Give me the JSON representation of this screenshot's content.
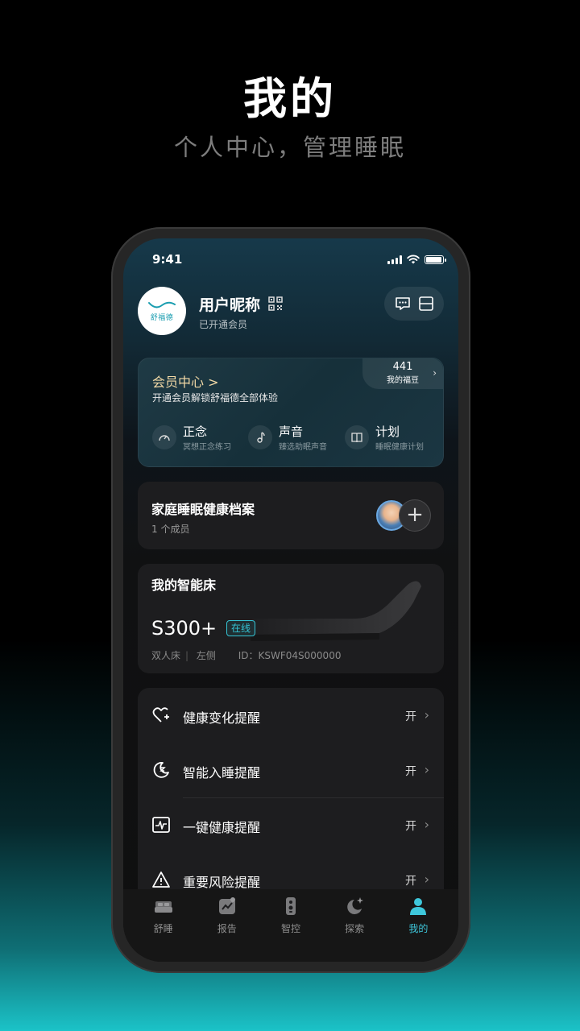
{
  "hero": {
    "title": "我的",
    "subtitle": "个人中心，管理睡眠"
  },
  "status_bar": {
    "time": "9:41",
    "battery_level": 0.95
  },
  "profile": {
    "avatar_brand": "舒福德",
    "nickname": "用户昵称",
    "member_status": "已开通会员",
    "actions": [
      "message-icon",
      "scan-icon"
    ]
  },
  "vip": {
    "title": "会员中心 >",
    "description": "开通会员解锁舒福德全部体验",
    "points_value": "441",
    "points_label": "我的福豆",
    "features": [
      {
        "title": "正念",
        "subtitle": "冥想正念练习",
        "icon": "gauge-icon"
      },
      {
        "title": "声音",
        "subtitle": "臻选助眠声音",
        "icon": "music-note-icon"
      },
      {
        "title": "计划",
        "subtitle": "睡眠健康计划",
        "icon": "book-icon"
      }
    ]
  },
  "family": {
    "title": "家庭睡眠健康档案",
    "count": "1 个成员",
    "add_label": "+"
  },
  "bed": {
    "title": "我的智能床",
    "model": "S300+",
    "status": "在线",
    "type": "双人床",
    "side": "左侧",
    "device_id": "ID：KSWF04S000000"
  },
  "reminders": [
    {
      "label": "健康变化提醒",
      "value": "开",
      "icon": "heart-plus-icon"
    },
    {
      "label": "智能入睡提醒",
      "value": "开",
      "icon": "moon-z-icon"
    },
    {
      "label": "一键健康提醒",
      "value": "开",
      "icon": "pulse-monitor-icon"
    },
    {
      "label": "重要风险提醒",
      "value": "开",
      "icon": "warning-icon"
    }
  ],
  "tabs": [
    {
      "label": "舒睡",
      "icon": "bed-icon",
      "active": false
    },
    {
      "label": "报告",
      "icon": "report-icon",
      "active": false
    },
    {
      "label": "智控",
      "icon": "remote-icon",
      "active": false
    },
    {
      "label": "探索",
      "icon": "moon-star-icon",
      "active": false
    },
    {
      "label": "我的",
      "icon": "person-icon",
      "active": true
    }
  ],
  "colors": {
    "accent": "#3ec7db",
    "gold": "#f2d9a6",
    "card": "#1d1d1f"
  }
}
